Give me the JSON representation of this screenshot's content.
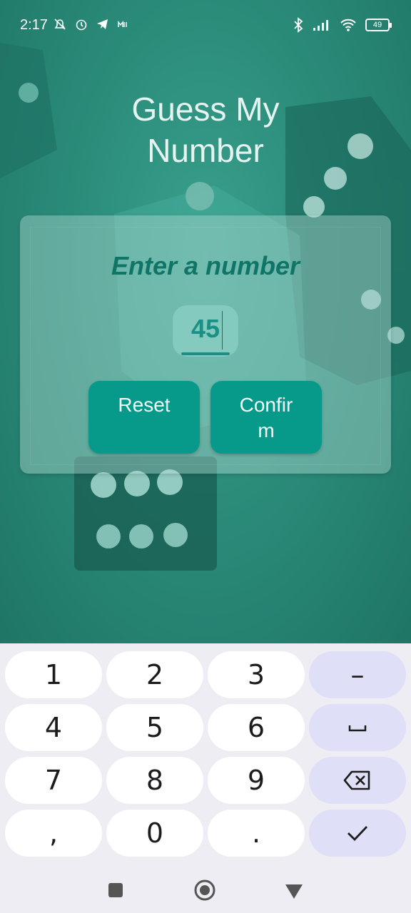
{
  "status_bar": {
    "time": "2:17",
    "battery": "49",
    "icons_left": [
      "mute-bell-icon",
      "alarm-icon",
      "telegram-icon",
      "mi-icon"
    ],
    "icons_right": [
      "bluetooth-icon",
      "signal-icon",
      "wifi-icon",
      "battery-icon"
    ]
  },
  "app": {
    "title_line1": "Guess My",
    "title_line2": "Number",
    "prompt": "Enter a number",
    "input_value": "45",
    "reset_label": "Reset",
    "confirm_label_line1": "Confir",
    "confirm_label_line2": "m"
  },
  "keyboard": {
    "keys": [
      "1",
      "2",
      "3",
      "–",
      "4",
      "5",
      "6",
      "␣",
      "7",
      "8",
      "9",
      "⌫",
      ",",
      "0",
      ".",
      "✓"
    ]
  },
  "colors": {
    "accent": "#079a8a",
    "prompt": "#0f7567",
    "keyboard_bg": "#eeedf4",
    "key_fn": "#dfe0f7"
  }
}
